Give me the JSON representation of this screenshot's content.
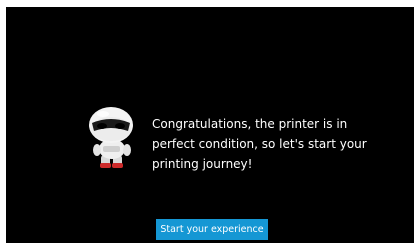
{
  "onboarding": {
    "message_lines": [
      "Congratulations, the printer is in",
      "perfect condition, so let's start your",
      "printing journey!"
    ],
    "start_button_label": "Start your experience",
    "mascot_icon": "robot-mascot-icon"
  },
  "colors": {
    "background": "#000000",
    "text": "#ffffff",
    "button": "#1597d4"
  }
}
